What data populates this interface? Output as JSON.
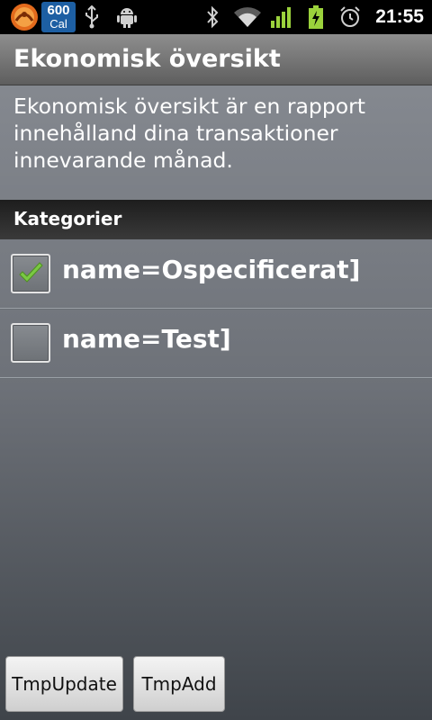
{
  "status_bar": {
    "cal_badge_number": "600",
    "cal_badge_unit": "Cal",
    "time": "21:55",
    "icons": [
      "app-logo-icon",
      "calorie-badge",
      "usb-icon",
      "android-debug-icon",
      "bluetooth-icon",
      "wifi-icon",
      "signal-icon",
      "battery-charging-icon",
      "alarm-icon"
    ]
  },
  "title_bar": {
    "title": "Ekonomisk översikt"
  },
  "description": "Ekonomisk översikt är en rapport innehålland dina transaktioner innevarande månad.",
  "section": {
    "header": "Kategorier"
  },
  "categories": [
    {
      "label": "name=Ospecificerat]",
      "checked": true
    },
    {
      "label": "name=Test]",
      "checked": false
    }
  ],
  "buttons": {
    "update": "TmpUpdate",
    "add": "TmpAdd"
  },
  "colors": {
    "check": "#7ac943",
    "status_bar": "#000000",
    "badge": "#1d5fa3"
  }
}
